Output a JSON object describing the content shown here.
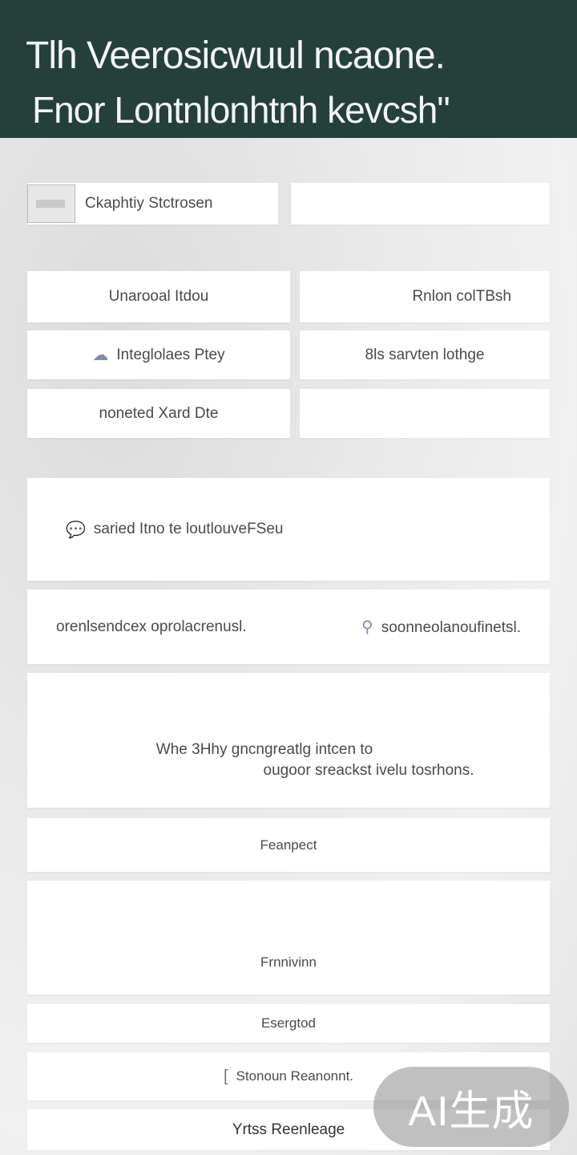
{
  "header": {
    "line1": "Tlh Veerosicwuul ncaone.",
    "line2": "Fnor Lontnlonhtnh kevcsh\""
  },
  "top_row": {
    "left_label": "Ckaphtiy Stctrosen",
    "right_value": ""
  },
  "grid": [
    {
      "label": "Unarooal Itdou"
    },
    {
      "label": "Rnlon colTBsh"
    },
    {
      "label": "Integlolaes Ptey"
    },
    {
      "label": "8ls sarvten lothge"
    },
    {
      "label": "noneted Xard Dte"
    },
    {
      "label": ""
    }
  ],
  "section1": {
    "text": "saried Itno te loutlouveFSeu"
  },
  "section2": {
    "left": "orenlsendcex oprolacrenusl.",
    "right": "soonneolanoufinetsl."
  },
  "section3": {
    "line1": "Whe 3Hhy gncngreatlg intcen to",
    "line2": "ougoor sreackst ivelu tosrhons."
  },
  "buttons": [
    {
      "label": "Feanpect"
    },
    {
      "label": "Frnnivinn"
    },
    {
      "label": "Esergtod"
    },
    {
      "label": "Stonoun Reanonnt."
    },
    {
      "label": "Yrtss Reenleage"
    }
  ],
  "watermark": {
    "text": "AI生成"
  }
}
